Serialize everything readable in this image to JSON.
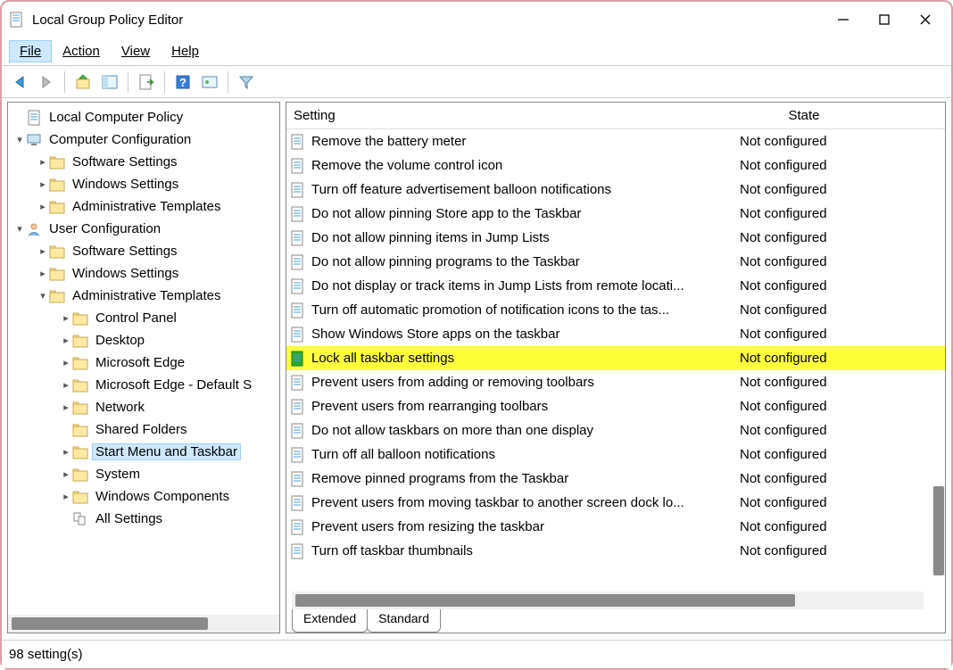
{
  "app": {
    "title": "Local Group Policy Editor"
  },
  "menu": {
    "file": "File",
    "action": "Action",
    "view": "View",
    "help": "Help"
  },
  "tree": [
    {
      "depth": 0,
      "expander": "",
      "icon": "policy-doc",
      "label": "Local Computer Policy"
    },
    {
      "depth": 0,
      "expander": "v",
      "icon": "computer",
      "label": "Computer Configuration"
    },
    {
      "depth": 1,
      "expander": ">",
      "icon": "folder",
      "label": "Software Settings"
    },
    {
      "depth": 1,
      "expander": ">",
      "icon": "folder",
      "label": "Windows Settings"
    },
    {
      "depth": 1,
      "expander": ">",
      "icon": "folder",
      "label": "Administrative Templates"
    },
    {
      "depth": 0,
      "expander": "v",
      "icon": "user",
      "label": "User Configuration"
    },
    {
      "depth": 1,
      "expander": ">",
      "icon": "folder",
      "label": "Software Settings"
    },
    {
      "depth": 1,
      "expander": ">",
      "icon": "folder",
      "label": "Windows Settings"
    },
    {
      "depth": 1,
      "expander": "v",
      "icon": "folder",
      "label": "Administrative Templates"
    },
    {
      "depth": 2,
      "expander": ">",
      "icon": "folder",
      "label": "Control Panel"
    },
    {
      "depth": 2,
      "expander": ">",
      "icon": "folder",
      "label": "Desktop"
    },
    {
      "depth": 2,
      "expander": ">",
      "icon": "folder",
      "label": "Microsoft Edge"
    },
    {
      "depth": 2,
      "expander": ">",
      "icon": "folder",
      "label": "Microsoft Edge - Default S"
    },
    {
      "depth": 2,
      "expander": ">",
      "icon": "folder",
      "label": "Network"
    },
    {
      "depth": 2,
      "expander": "",
      "icon": "folder",
      "label": "Shared Folders"
    },
    {
      "depth": 2,
      "expander": ">",
      "icon": "folder",
      "label": "Start Menu and Taskbar",
      "selected": true
    },
    {
      "depth": 2,
      "expander": ">",
      "icon": "folder",
      "label": "System"
    },
    {
      "depth": 2,
      "expander": ">",
      "icon": "folder",
      "label": "Windows Components"
    },
    {
      "depth": 2,
      "expander": "",
      "icon": "all",
      "label": "All Settings"
    }
  ],
  "columns": {
    "setting": "Setting",
    "state": "State"
  },
  "settings": [
    {
      "label": "Remove the battery meter",
      "state": "Not configured"
    },
    {
      "label": "Remove the volume control icon",
      "state": "Not configured"
    },
    {
      "label": "Turn off feature advertisement balloon notifications",
      "state": "Not configured"
    },
    {
      "label": "Do not allow pinning Store app to the Taskbar",
      "state": "Not configured"
    },
    {
      "label": "Do not allow pinning items in Jump Lists",
      "state": "Not configured"
    },
    {
      "label": "Do not allow pinning programs to the Taskbar",
      "state": "Not configured"
    },
    {
      "label": "Do not display or track items in Jump Lists from remote locati...",
      "state": "Not configured"
    },
    {
      "label": "Turn off automatic promotion of notification icons to the tas...",
      "state": "Not configured"
    },
    {
      "label": "Show Windows Store apps on the taskbar",
      "state": "Not configured"
    },
    {
      "label": "Lock all taskbar settings",
      "state": "Not configured",
      "highlight": true
    },
    {
      "label": "Prevent users from adding or removing toolbars",
      "state": "Not configured"
    },
    {
      "label": "Prevent users from rearranging toolbars",
      "state": "Not configured"
    },
    {
      "label": "Do not allow taskbars on more than one display",
      "state": "Not configured"
    },
    {
      "label": "Turn off all balloon notifications",
      "state": "Not configured"
    },
    {
      "label": "Remove pinned programs from the Taskbar",
      "state": "Not configured"
    },
    {
      "label": "Prevent users from moving taskbar to another screen dock lo...",
      "state": "Not configured"
    },
    {
      "label": "Prevent users from resizing the taskbar",
      "state": "Not configured"
    },
    {
      "label": "Turn off taskbar thumbnails",
      "state": "Not configured"
    }
  ],
  "tabs": {
    "extended": "Extended",
    "standard": "Standard"
  },
  "status": "98 setting(s)"
}
